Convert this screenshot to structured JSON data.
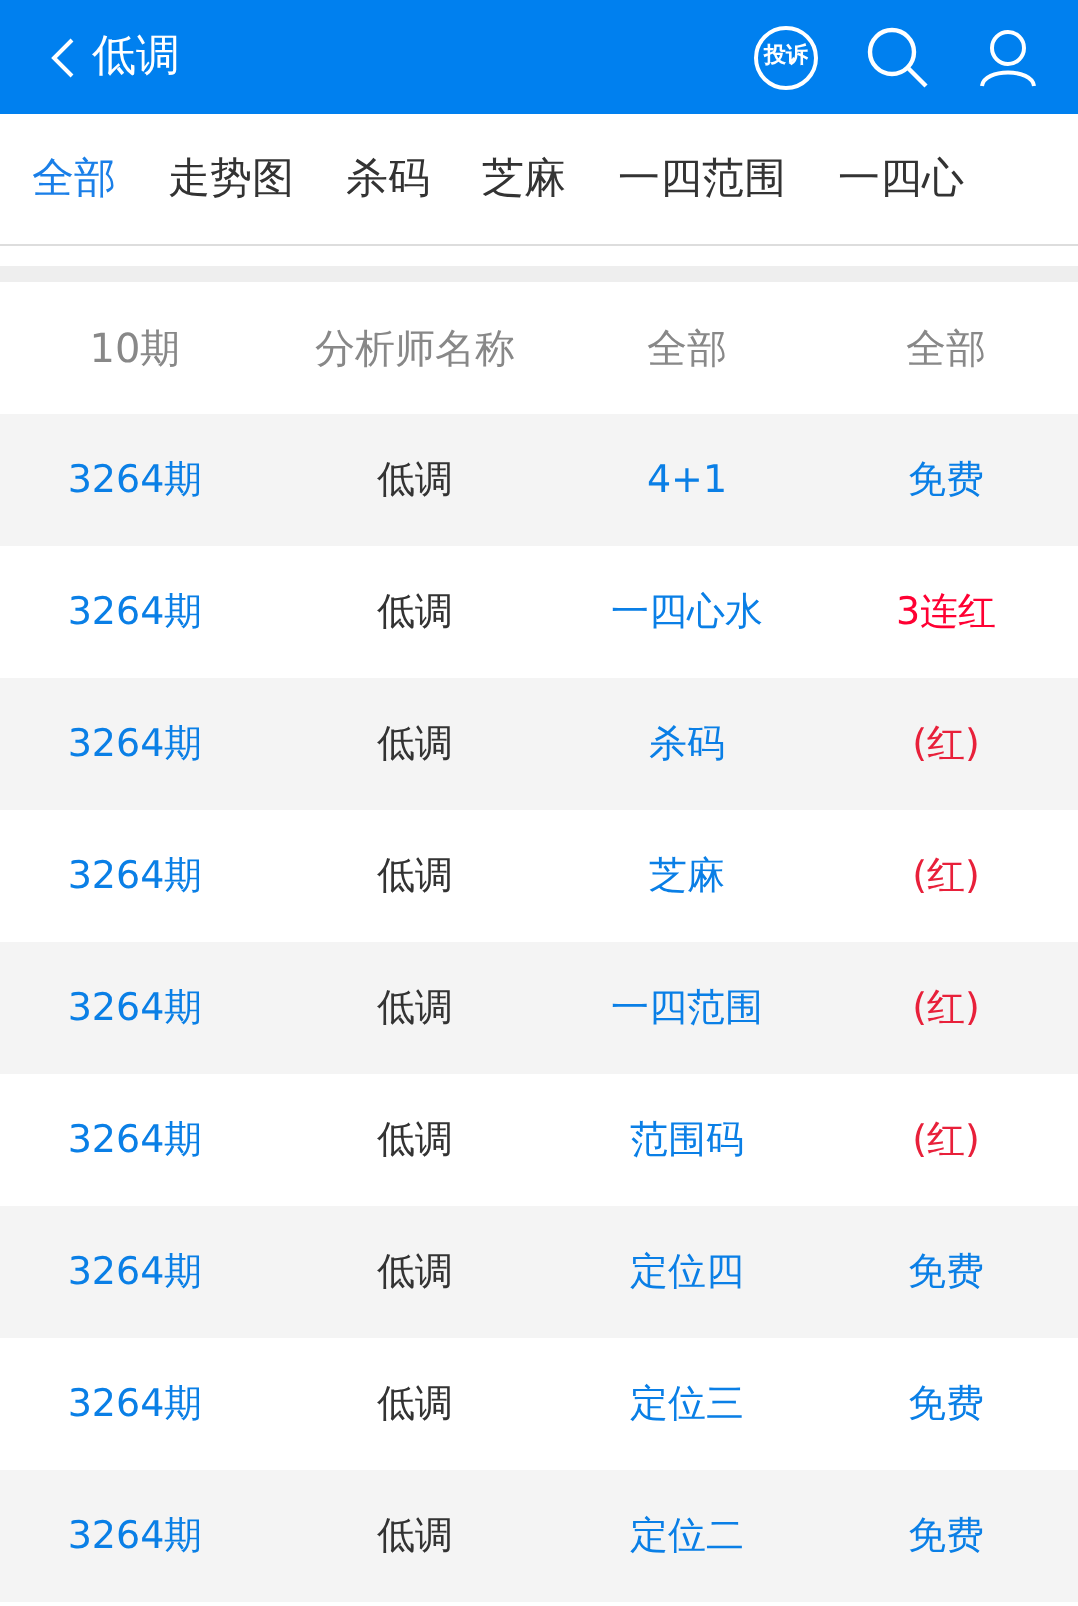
{
  "header": {
    "title": "低调",
    "complaint": "投诉"
  },
  "tabs": [
    {
      "label": "全部",
      "selected": true
    },
    {
      "label": "走势图",
      "selected": false
    },
    {
      "label": "杀码",
      "selected": false
    },
    {
      "label": "芝麻",
      "selected": false
    },
    {
      "label": "一四范围",
      "selected": false
    },
    {
      "label": "一四心",
      "selected": false
    }
  ],
  "table": {
    "columns": [
      "10期",
      "分析师名称",
      "全部",
      "全部"
    ],
    "rows": [
      {
        "issue": "3264期",
        "analyst": "低调",
        "category": "4+1",
        "result": "免费",
        "color": "#0a7fe6"
      },
      {
        "issue": "3264期",
        "analyst": "低调",
        "category": "一四心水",
        "result": "3连红",
        "color": "#ff0033"
      },
      {
        "issue": "3264期",
        "analyst": "低调",
        "category": "杀码",
        "result": "(红)",
        "color": "#e8203a"
      },
      {
        "issue": "3264期",
        "analyst": "低调",
        "category": "芝麻",
        "result": "(红)",
        "color": "#e8203a"
      },
      {
        "issue": "3264期",
        "analyst": "低调",
        "category": "一四范围",
        "result": "(红)",
        "color": "#e8203a"
      },
      {
        "issue": "3264期",
        "analyst": "低调",
        "category": "范围码",
        "result": "(红)",
        "color": "#e8203a"
      },
      {
        "issue": "3264期",
        "analyst": "低调",
        "category": "定位四",
        "result": "免费",
        "color": "#0a7fe6"
      },
      {
        "issue": "3264期",
        "analyst": "低调",
        "category": "定位三",
        "result": "免费",
        "color": "#0a7fe6"
      },
      {
        "issue": "3264期",
        "analyst": "低调",
        "category": "定位二",
        "result": "免费",
        "color": "#0a7fe6"
      }
    ]
  }
}
